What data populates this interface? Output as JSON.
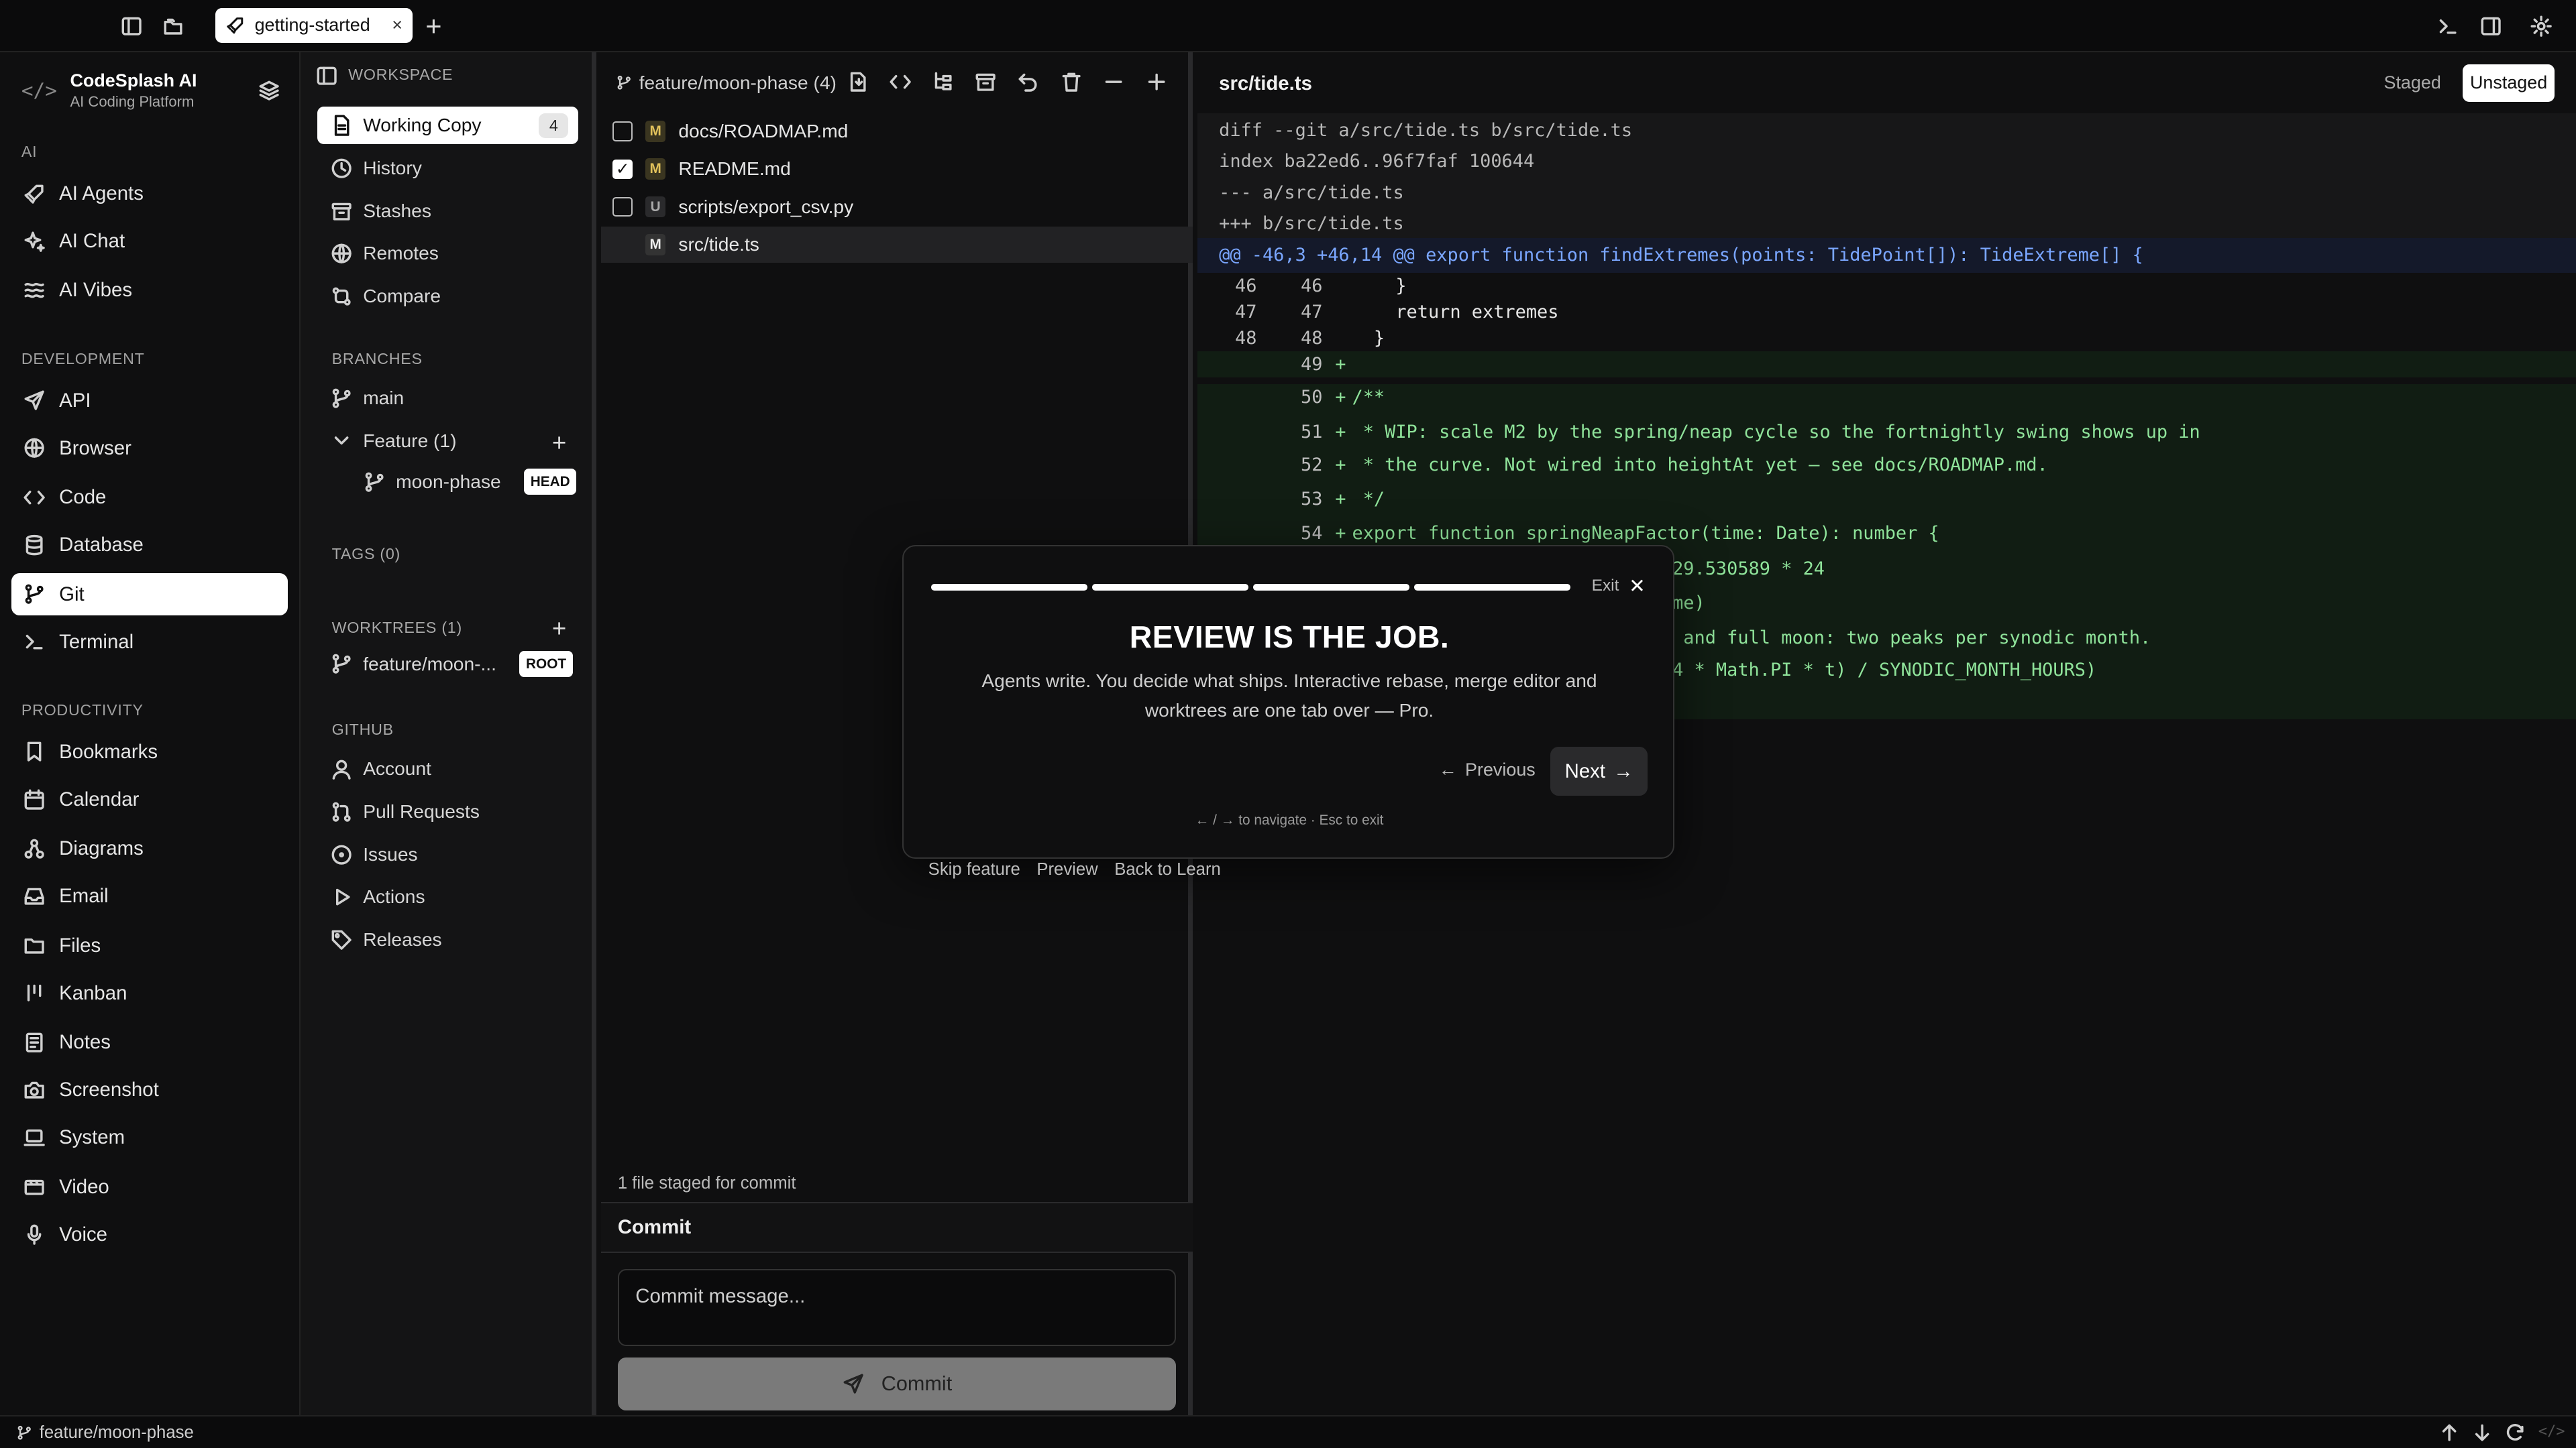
{
  "topbar": {
    "tab_label": "getting-started",
    "tab_close": "×",
    "new_tab": "+"
  },
  "sidebar": {
    "brand_name": "CodeSplash AI",
    "brand_sub": "AI Coding Platform",
    "sections": [
      {
        "label": "AI",
        "items": [
          {
            "label": "AI Agents",
            "icon": "rocket-icon"
          },
          {
            "label": "AI Chat",
            "icon": "sparkle-icon"
          },
          {
            "label": "AI Vibes",
            "icon": "waves-icon"
          }
        ]
      },
      {
        "label": "DEVELOPMENT",
        "items": [
          {
            "label": "API",
            "icon": "send-icon"
          },
          {
            "label": "Browser",
            "icon": "globe-icon"
          },
          {
            "label": "Code",
            "icon": "code-icon"
          },
          {
            "label": "Database",
            "icon": "database-icon"
          },
          {
            "label": "Git",
            "icon": "git-branch-icon",
            "active": true
          },
          {
            "label": "Terminal",
            "icon": "terminal-icon"
          }
        ]
      },
      {
        "label": "PRODUCTIVITY",
        "items": [
          {
            "label": "Bookmarks",
            "icon": "bookmark-icon"
          },
          {
            "label": "Calendar",
            "icon": "calendar-icon"
          },
          {
            "label": "Diagrams",
            "icon": "diagram-icon"
          },
          {
            "label": "Email",
            "icon": "inbox-icon"
          },
          {
            "label": "Files",
            "icon": "folder-icon"
          },
          {
            "label": "Kanban",
            "icon": "kanban-icon"
          },
          {
            "label": "Notes",
            "icon": "notes-icon"
          },
          {
            "label": "Screenshot",
            "icon": "camera-icon"
          },
          {
            "label": "System",
            "icon": "laptop-icon"
          },
          {
            "label": "Video",
            "icon": "video-icon"
          },
          {
            "label": "Voice",
            "icon": "mic-icon"
          }
        ]
      }
    ]
  },
  "workspace": {
    "title": "WORKSPACE",
    "items": [
      {
        "label": "Working Copy",
        "count": "4",
        "active": true
      },
      {
        "label": "History"
      },
      {
        "label": "Stashes"
      },
      {
        "label": "Remotes"
      },
      {
        "label": "Compare"
      }
    ],
    "branches_label": "BRANCHES",
    "branch_main": "main",
    "feature_group": "Feature (1)",
    "feature_branch": "moon-phase",
    "head_badge": "HEAD",
    "tags_label": "TAGS (0)",
    "worktrees_label": "WORKTREES (1)",
    "worktree_name": "feature/moon-...",
    "root_badge": "ROOT",
    "github_label": "GITHUB",
    "github_items": [
      "Account",
      "Pull Requests",
      "Issues",
      "Actions",
      "Releases"
    ]
  },
  "files": {
    "branch": "feature/moon-phase (4)",
    "rows": [
      {
        "status": "M",
        "name": "docs/ROADMAP.md",
        "checked": false
      },
      {
        "status": "M",
        "name": "README.md",
        "checked": true
      },
      {
        "status": "U",
        "name": "scripts/export_csv.py",
        "checked": false
      },
      {
        "status": "M",
        "name": "src/tide.ts",
        "checked": false,
        "active": true
      }
    ],
    "staged_note": "1 file staged for commit",
    "commit_title": "Commit",
    "commit_placeholder": "Commit message...",
    "commit_button": "Commit"
  },
  "diff": {
    "file": "src/tide.ts",
    "staged_label": "Staged",
    "unstaged_label": "Unstaged",
    "header_lines": [
      "diff --git a/src/tide.ts b/src/tide.ts",
      "index ba22ed6..96f7faf 100644",
      "--- a/src/tide.ts",
      "+++ b/src/tide.ts"
    ],
    "hunk": "@@ -46,3 +46,14 @@ export function findExtremes(points: TidePoint[]): TideExtreme[] {",
    "lines": [
      {
        "old": "46",
        "new": "46",
        "sign": "",
        "text": "    }"
      },
      {
        "old": "47",
        "new": "47",
        "sign": "",
        "text": "    return extremes"
      },
      {
        "old": "48",
        "new": "48",
        "sign": "",
        "text": "  }"
      },
      {
        "old": "",
        "new": "49",
        "sign": "+",
        "text": ""
      },
      {
        "old": "",
        "new": "50",
        "sign": "+",
        "text": "/**"
      },
      {
        "old": "",
        "new": "51",
        "sign": "+",
        "text": " * WIP: scale M2 by the spring/neap cycle so the fortnightly swing shows up in"
      },
      {
        "old": "",
        "new": "52",
        "sign": "+",
        "text": " * the curve. Not wired into heightAt yet — see docs/ROADMAP.md."
      },
      {
        "old": "",
        "new": "53",
        "sign": "+",
        "text": " */"
      },
      {
        "old": "",
        "new": "54",
        "sign": "+",
        "text": "export function springNeapFactor(time: Date): number {"
      }
    ],
    "partial_lines": [
      "29.530589 * 24",
      "me)",
      " and full moon: two peaks per synodic month.",
      "4 * Math.PI * t) / SYNODIC_MONTH_HOURS)"
    ]
  },
  "tour": {
    "exit_label": "Exit",
    "title": "REVIEW IS THE JOB.",
    "body": "Agents write. You decide what ships. Interactive rebase, merge editor and worktrees are one tab over — Pro.",
    "previous": "Previous",
    "next": "Next",
    "hint": "← / → to navigate · Esc to exit",
    "links": [
      "Skip feature",
      "Preview",
      "Back to Learn"
    ]
  },
  "statusbar": {
    "branch": "feature/moon-phase"
  }
}
